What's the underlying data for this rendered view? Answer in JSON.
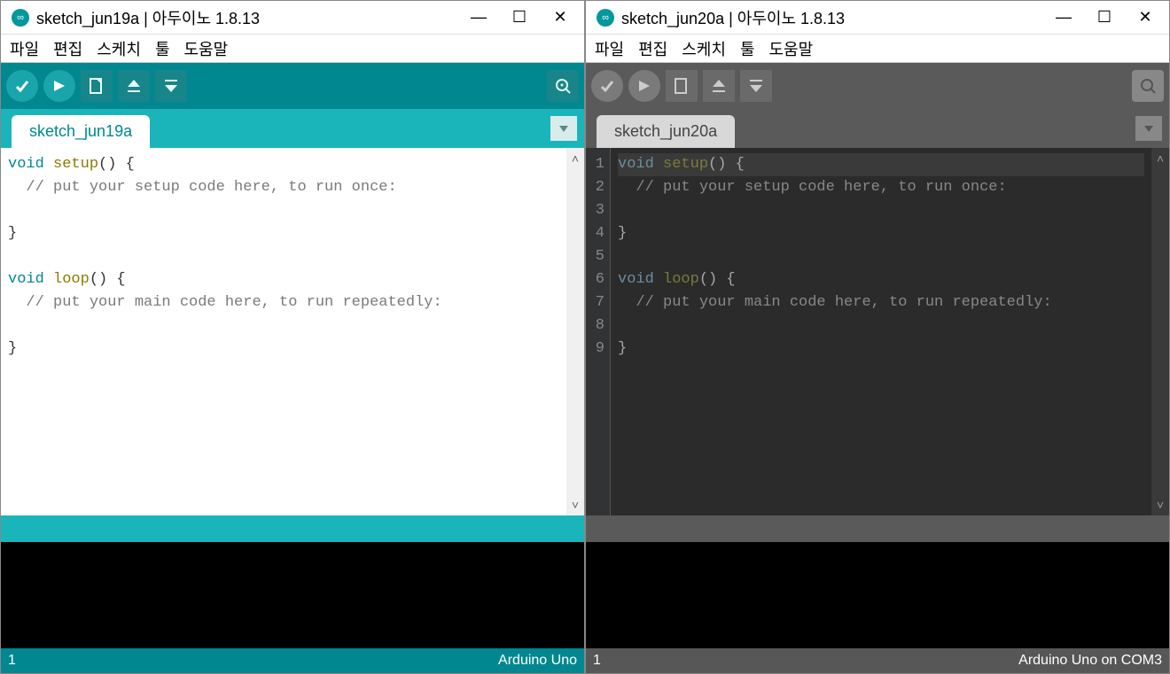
{
  "left": {
    "title": "sketch_jun19a | 아두이노 1.8.13",
    "menus": [
      "파일",
      "편집",
      "스케치",
      "툴",
      "도움말"
    ],
    "tab": "sketch_jun19a",
    "code": {
      "l1_kw": "void",
      "l1_fn": "setup",
      "l1_rest": "() {",
      "l2": "  // put your setup code here, to run once:",
      "l3": "",
      "l4": "}",
      "l5": "",
      "l6_kw": "void",
      "l6_fn": "loop",
      "l6_rest": "() {",
      "l7": "  // put your main code here, to run repeatedly:",
      "l8": "",
      "l9": "}"
    },
    "status_left": "1",
    "status_right": "Arduino Uno"
  },
  "right": {
    "title": "sketch_jun20a | 아두이노 1.8.13",
    "menus": [
      "파일",
      "편집",
      "스케치",
      "툴",
      "도움말"
    ],
    "tab": "sketch_jun20a",
    "line_numbers": [
      "1",
      "2",
      "3",
      "4",
      "5",
      "6",
      "7",
      "8",
      "9"
    ],
    "code": {
      "l1_kw": "void",
      "l1_fn": "setup",
      "l1_rest": "() {",
      "l2": "  // put your setup code here, to run once:",
      "l3": "",
      "l4": "}",
      "l5": "",
      "l6_kw": "void",
      "l6_fn": "loop",
      "l6_rest": "() {",
      "l7": "  // put your main code here, to run repeatedly:",
      "l8": "",
      "l9": "}"
    },
    "status_left": "1",
    "status_right": "Arduino Uno on COM3"
  }
}
